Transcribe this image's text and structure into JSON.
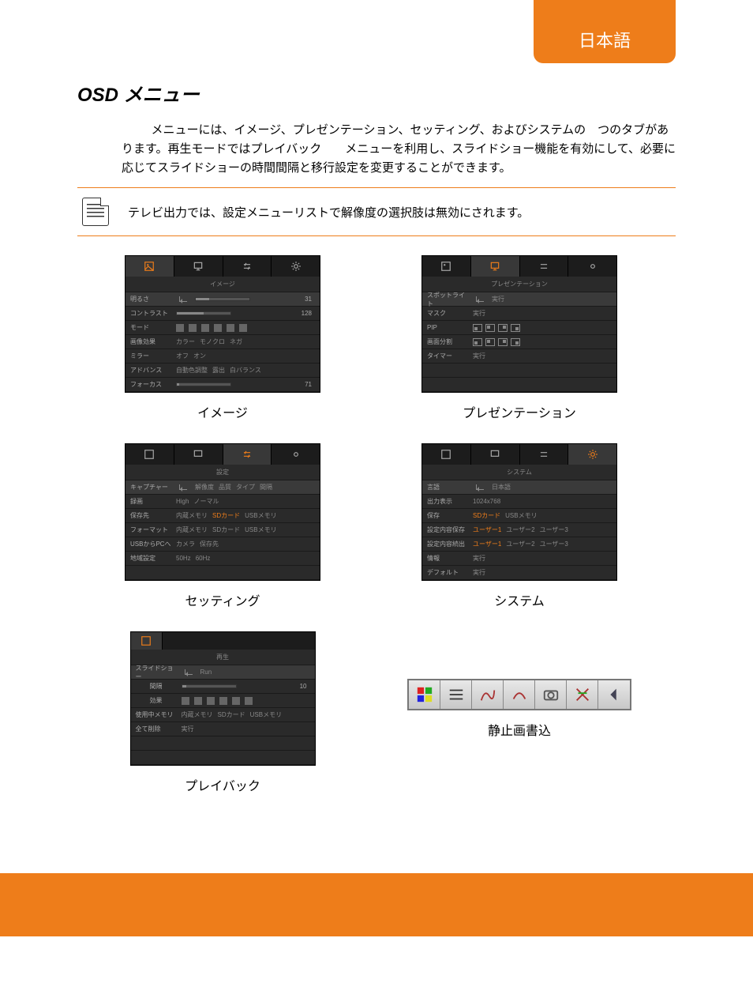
{
  "header": {
    "lang": "日本語"
  },
  "title": {
    "osd": "OSD",
    "suffix": " メニュー"
  },
  "intro": "メニューには、イメージ、プレゼンテーション、セッティング、およびシステムの　つのタブがあります。再生モードではプレイバック　　メニューを利用し、スライドショー機能を有効にして、必要に応じてスライドショーの時間間隔と移行設定を変更することができます。",
  "note": "テレビ出力では、設定メニューリストで解像度の選択肢は無効にされます。",
  "captions": {
    "image": "イメージ",
    "presentation": "プレゼンテーション",
    "setting": "セッティング",
    "system": "システム",
    "playback": "プレイバック",
    "annotation": "静止画書込"
  },
  "image_panel": {
    "title": "イメージ",
    "rows": {
      "brightness": {
        "label": "明るさ",
        "value": "31"
      },
      "contrast": {
        "label": "コントラスト",
        "value": "128"
      },
      "mode": {
        "label": "モード"
      },
      "effect": {
        "label": "画像効果",
        "opts": [
          "カラー",
          "モノクロ",
          "ネガ"
        ]
      },
      "mirror": {
        "label": "ミラー",
        "opts": [
          "オフ",
          "オン"
        ]
      },
      "advance": {
        "label": "アドバンス",
        "opts": [
          "自動色調整",
          "露出",
          "白バランス"
        ]
      },
      "focus": {
        "label": "フォーカス",
        "value": "71"
      }
    }
  },
  "presentation_panel": {
    "title": "プレゼンテーション",
    "rows": {
      "spotlight": {
        "label": "スポットライト",
        "opt": "実行"
      },
      "mask": {
        "label": "マスク",
        "opt": "実行"
      },
      "pip": {
        "label": "PIP"
      },
      "split": {
        "label": "画面分割"
      },
      "timer": {
        "label": "タイマー",
        "opt": "実行"
      }
    }
  },
  "setting_panel": {
    "title": "設定",
    "rows": {
      "capture": {
        "label": "キャプチャー",
        "opts": [
          "解像度",
          "品質",
          "タイプ",
          "間隔"
        ]
      },
      "record": {
        "label": "録画",
        "opts": [
          "High",
          "ノーマル"
        ]
      },
      "saveto": {
        "label": "保存先",
        "opts": [
          "内蔵メモリ",
          "SDカード",
          "USBメモリ"
        ]
      },
      "format": {
        "label": "フォーマット",
        "opts": [
          "内蔵メモリ",
          "SDカード",
          "USBメモリ"
        ]
      },
      "usbpc": {
        "label": "USBからPCへ",
        "opts": [
          "カメラ",
          "保存先"
        ]
      },
      "region": {
        "label": "地域設定",
        "opts": [
          "50Hz",
          "60Hz"
        ]
      }
    }
  },
  "system_panel": {
    "title": "システム",
    "rows": {
      "lang": {
        "label": "言語",
        "opt": "日本語"
      },
      "output": {
        "label": "出力表示",
        "opt": "1024x768"
      },
      "save": {
        "label": "保存",
        "opts": [
          "SDカード",
          "USBメモリ"
        ]
      },
      "savecfg": {
        "label": "設定内容保存",
        "opts": [
          "ユーザー1",
          "ユーザー2",
          "ユーザー3"
        ]
      },
      "loadcfg": {
        "label": "設定内容続出",
        "opts": [
          "ユーザー1",
          "ユーザー2",
          "ユーザー3"
        ]
      },
      "info": {
        "label": "情報",
        "opt": "実行"
      },
      "default": {
        "label": "デフォルト",
        "opt": "実行"
      }
    }
  },
  "playback_panel": {
    "title": "再生",
    "rows": {
      "slideshow": {
        "label": "スライドショー",
        "opt": "Run"
      },
      "interval": {
        "label": "間隔",
        "value": "10"
      },
      "effect": {
        "label": "効果"
      },
      "usedmem": {
        "label": "使用中メモリ",
        "opts": [
          "内蔵メモリ",
          "SDカード",
          "USBメモリ"
        ]
      },
      "delall": {
        "label": "全て削除",
        "opt": "実行"
      }
    }
  }
}
